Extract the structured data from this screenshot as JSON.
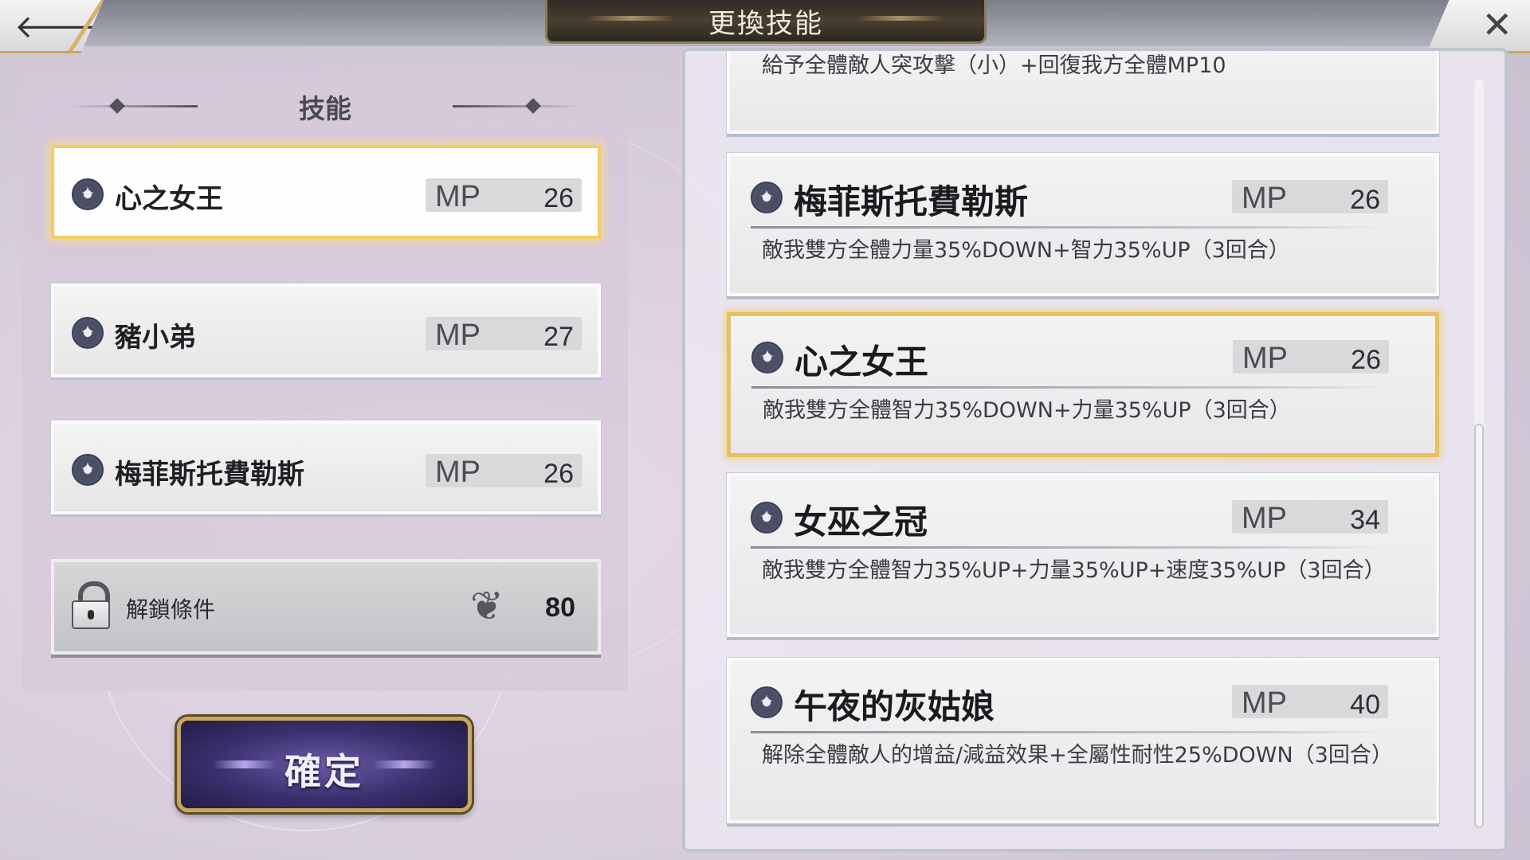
{
  "header": {
    "title": "更換技能",
    "back_icon": "back-arrow-icon",
    "close_icon": "close-icon"
  },
  "left": {
    "section_title": "技能",
    "skills": [
      {
        "name": "心之女王",
        "mp_label": "MP",
        "mp": "26",
        "selected": true
      },
      {
        "name": "豬小弟",
        "mp_label": "MP",
        "mp": "27",
        "selected": false
      },
      {
        "name": "梅菲斯托費勒斯",
        "mp_label": "MP",
        "mp": "26",
        "selected": false
      }
    ],
    "unlock": {
      "label": "解鎖條件",
      "count": "80",
      "icon": "feather-icon"
    },
    "confirm_label": "確定"
  },
  "right": {
    "partial_desc": "給予全體敵人突攻擊（小）+回復我方全體MP10",
    "skills": [
      {
        "name": "梅菲斯托費勒斯",
        "mp_label": "MP",
        "mp": "26",
        "desc": "敵我雙方全體力量35%DOWN+智力35%UP（3回合）",
        "selected": false
      },
      {
        "name": "心之女王",
        "mp_label": "MP",
        "mp": "26",
        "desc": "敵我雙方全體智力35%DOWN+力量35%UP（3回合）",
        "selected": true
      },
      {
        "name": "女巫之冠",
        "mp_label": "MP",
        "mp": "34",
        "desc": "敵我雙方全體智力35%UP+力量35%UP+速度35%UP（3回合）",
        "selected": false
      },
      {
        "name": "午夜的灰姑娘",
        "mp_label": "MP",
        "mp": "40",
        "desc": "解除全體敵人的增益/減益效果+全屬性耐性25%DOWN（3回合）",
        "selected": false
      }
    ]
  },
  "colors": {
    "selected_border": "#f2cd62",
    "confirm_bg": "#3a2f6e",
    "accent_gold": "#c9a85a"
  }
}
